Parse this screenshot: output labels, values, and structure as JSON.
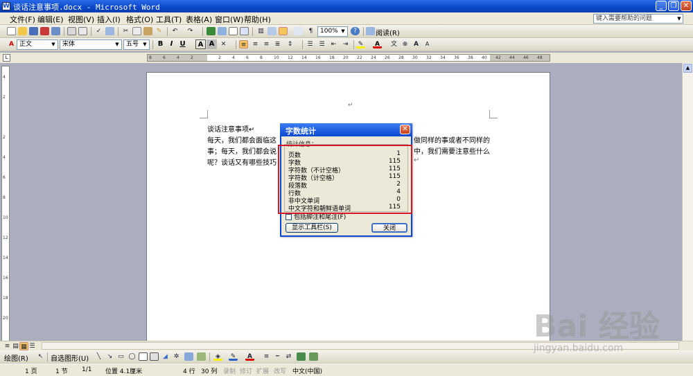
{
  "window": {
    "title": "谈话注意事项.docx - Microsoft Word",
    "app_icon": "W"
  },
  "menu": {
    "items": [
      "文件(F)",
      "编辑(E)",
      "视图(V)",
      "插入(I)",
      "格式(O)",
      "工具(T)",
      "表格(A)",
      "窗口(W)",
      "帮助(H)"
    ],
    "help_placeholder": "键入需要帮助的问题"
  },
  "toolbar": {
    "zoom": "100%",
    "read_label": "阅读(R)"
  },
  "format_toolbar": {
    "style": "正文",
    "font": "宋体",
    "size": "五号",
    "bold": "B",
    "italic": "I",
    "underline": "U",
    "char_a": "A"
  },
  "ruler": {
    "ticks": [
      "8",
      "6",
      "4",
      "2",
      "",
      "2",
      "4",
      "6",
      "8",
      "10",
      "12",
      "14",
      "16",
      "18",
      "20",
      "22",
      "24",
      "26",
      "28",
      "30",
      "32",
      "34",
      "36",
      "38",
      "40",
      "42",
      "44",
      "46",
      "48"
    ],
    "vticks": [
      "4",
      "2",
      "",
      "2",
      "4",
      "6",
      "8",
      "10",
      "12",
      "14",
      "16",
      "18",
      "20"
    ]
  },
  "document": {
    "paragraph_mark": "↵",
    "title_line": "谈话注意事项↵",
    "line2_left": "每天，我们都会面临这",
    "line2_right": "做同样的事或者不同样的",
    "line3_left": "事；每天，我们都会说",
    "line3_right": "中，我们需要注意些什么",
    "line4_left": "呢？谈话又有哪些技巧",
    "line4_right": "↵"
  },
  "dialog": {
    "title": "字数统计",
    "group_label": "统计信息：",
    "rows": [
      {
        "label": "页数",
        "value": "1"
      },
      {
        "label": "字数",
        "value": "115"
      },
      {
        "label": "字符数（不计空格）",
        "value": "115"
      },
      {
        "label": "字符数（计空格）",
        "value": "115"
      },
      {
        "label": "段落数",
        "value": "2"
      },
      {
        "label": "行数",
        "value": "4"
      },
      {
        "label": "非中文单词",
        "value": "0"
      },
      {
        "label": "中文字符和朝鲜语单词",
        "value": "115"
      }
    ],
    "checkbox_label": "包括脚注和尾注(F)",
    "show_toolbar_button": "显示工具栏(S)",
    "close_button": "关闭"
  },
  "drawbar": {
    "draw_label": "绘图(R)",
    "autoshape_label": "自选图形(U)"
  },
  "status": {
    "page": "1 页",
    "section": "1 节",
    "page_of": "1/1",
    "position": "位置 4.1厘米",
    "line": "4 行",
    "col": "30 列",
    "rec": "录制",
    "trk": "修订",
    "ext": "扩展",
    "ovr": "改写",
    "lang": "中文(中国)"
  },
  "watermark": {
    "brand": "Bai 经验",
    "url": "jingyan.baidu.com"
  },
  "colors": {
    "title_blue": "#0b47c8",
    "highlight_red": "#d0182a",
    "chrome": "#ece9d8"
  }
}
